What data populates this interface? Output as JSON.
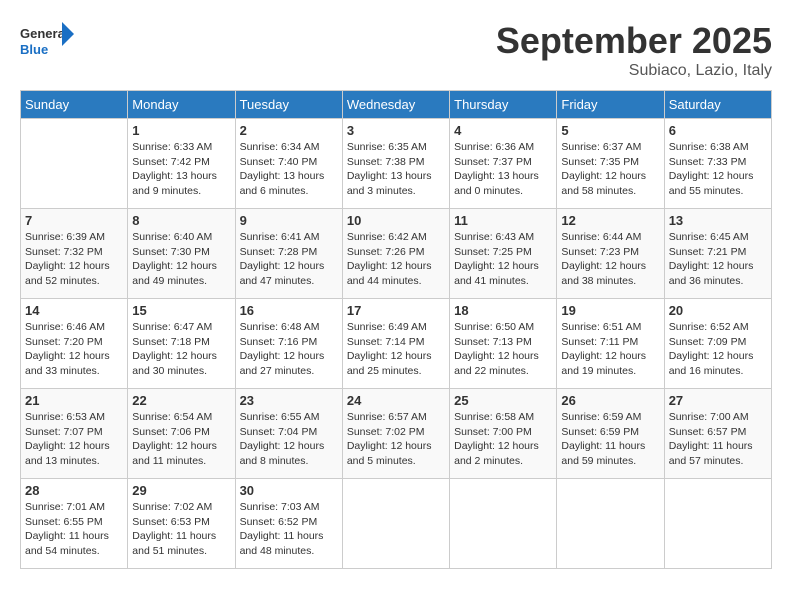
{
  "header": {
    "logo_general": "General",
    "logo_blue": "Blue",
    "month_title": "September 2025",
    "subtitle": "Subiaco, Lazio, Italy"
  },
  "weekdays": [
    "Sunday",
    "Monday",
    "Tuesday",
    "Wednesday",
    "Thursday",
    "Friday",
    "Saturday"
  ],
  "weeks": [
    [
      {
        "day": "",
        "sunrise": "",
        "sunset": "",
        "daylight": ""
      },
      {
        "day": "1",
        "sunrise": "Sunrise: 6:33 AM",
        "sunset": "Sunset: 7:42 PM",
        "daylight": "Daylight: 13 hours and 9 minutes."
      },
      {
        "day": "2",
        "sunrise": "Sunrise: 6:34 AM",
        "sunset": "Sunset: 7:40 PM",
        "daylight": "Daylight: 13 hours and 6 minutes."
      },
      {
        "day": "3",
        "sunrise": "Sunrise: 6:35 AM",
        "sunset": "Sunset: 7:38 PM",
        "daylight": "Daylight: 13 hours and 3 minutes."
      },
      {
        "day": "4",
        "sunrise": "Sunrise: 6:36 AM",
        "sunset": "Sunset: 7:37 PM",
        "daylight": "Daylight: 13 hours and 0 minutes."
      },
      {
        "day": "5",
        "sunrise": "Sunrise: 6:37 AM",
        "sunset": "Sunset: 7:35 PM",
        "daylight": "Daylight: 12 hours and 58 minutes."
      },
      {
        "day": "6",
        "sunrise": "Sunrise: 6:38 AM",
        "sunset": "Sunset: 7:33 PM",
        "daylight": "Daylight: 12 hours and 55 minutes."
      }
    ],
    [
      {
        "day": "7",
        "sunrise": "Sunrise: 6:39 AM",
        "sunset": "Sunset: 7:32 PM",
        "daylight": "Daylight: 12 hours and 52 minutes."
      },
      {
        "day": "8",
        "sunrise": "Sunrise: 6:40 AM",
        "sunset": "Sunset: 7:30 PM",
        "daylight": "Daylight: 12 hours and 49 minutes."
      },
      {
        "day": "9",
        "sunrise": "Sunrise: 6:41 AM",
        "sunset": "Sunset: 7:28 PM",
        "daylight": "Daylight: 12 hours and 47 minutes."
      },
      {
        "day": "10",
        "sunrise": "Sunrise: 6:42 AM",
        "sunset": "Sunset: 7:26 PM",
        "daylight": "Daylight: 12 hours and 44 minutes."
      },
      {
        "day": "11",
        "sunrise": "Sunrise: 6:43 AM",
        "sunset": "Sunset: 7:25 PM",
        "daylight": "Daylight: 12 hours and 41 minutes."
      },
      {
        "day": "12",
        "sunrise": "Sunrise: 6:44 AM",
        "sunset": "Sunset: 7:23 PM",
        "daylight": "Daylight: 12 hours and 38 minutes."
      },
      {
        "day": "13",
        "sunrise": "Sunrise: 6:45 AM",
        "sunset": "Sunset: 7:21 PM",
        "daylight": "Daylight: 12 hours and 36 minutes."
      }
    ],
    [
      {
        "day": "14",
        "sunrise": "Sunrise: 6:46 AM",
        "sunset": "Sunset: 7:20 PM",
        "daylight": "Daylight: 12 hours and 33 minutes."
      },
      {
        "day": "15",
        "sunrise": "Sunrise: 6:47 AM",
        "sunset": "Sunset: 7:18 PM",
        "daylight": "Daylight: 12 hours and 30 minutes."
      },
      {
        "day": "16",
        "sunrise": "Sunrise: 6:48 AM",
        "sunset": "Sunset: 7:16 PM",
        "daylight": "Daylight: 12 hours and 27 minutes."
      },
      {
        "day": "17",
        "sunrise": "Sunrise: 6:49 AM",
        "sunset": "Sunset: 7:14 PM",
        "daylight": "Daylight: 12 hours and 25 minutes."
      },
      {
        "day": "18",
        "sunrise": "Sunrise: 6:50 AM",
        "sunset": "Sunset: 7:13 PM",
        "daylight": "Daylight: 12 hours and 22 minutes."
      },
      {
        "day": "19",
        "sunrise": "Sunrise: 6:51 AM",
        "sunset": "Sunset: 7:11 PM",
        "daylight": "Daylight: 12 hours and 19 minutes."
      },
      {
        "day": "20",
        "sunrise": "Sunrise: 6:52 AM",
        "sunset": "Sunset: 7:09 PM",
        "daylight": "Daylight: 12 hours and 16 minutes."
      }
    ],
    [
      {
        "day": "21",
        "sunrise": "Sunrise: 6:53 AM",
        "sunset": "Sunset: 7:07 PM",
        "daylight": "Daylight: 12 hours and 13 minutes."
      },
      {
        "day": "22",
        "sunrise": "Sunrise: 6:54 AM",
        "sunset": "Sunset: 7:06 PM",
        "daylight": "Daylight: 12 hours and 11 minutes."
      },
      {
        "day": "23",
        "sunrise": "Sunrise: 6:55 AM",
        "sunset": "Sunset: 7:04 PM",
        "daylight": "Daylight: 12 hours and 8 minutes."
      },
      {
        "day": "24",
        "sunrise": "Sunrise: 6:57 AM",
        "sunset": "Sunset: 7:02 PM",
        "daylight": "Daylight: 12 hours and 5 minutes."
      },
      {
        "day": "25",
        "sunrise": "Sunrise: 6:58 AM",
        "sunset": "Sunset: 7:00 PM",
        "daylight": "Daylight: 12 hours and 2 minutes."
      },
      {
        "day": "26",
        "sunrise": "Sunrise: 6:59 AM",
        "sunset": "Sunset: 6:59 PM",
        "daylight": "Daylight: 11 hours and 59 minutes."
      },
      {
        "day": "27",
        "sunrise": "Sunrise: 7:00 AM",
        "sunset": "Sunset: 6:57 PM",
        "daylight": "Daylight: 11 hours and 57 minutes."
      }
    ],
    [
      {
        "day": "28",
        "sunrise": "Sunrise: 7:01 AM",
        "sunset": "Sunset: 6:55 PM",
        "daylight": "Daylight: 11 hours and 54 minutes."
      },
      {
        "day": "29",
        "sunrise": "Sunrise: 7:02 AM",
        "sunset": "Sunset: 6:53 PM",
        "daylight": "Daylight: 11 hours and 51 minutes."
      },
      {
        "day": "30",
        "sunrise": "Sunrise: 7:03 AM",
        "sunset": "Sunset: 6:52 PM",
        "daylight": "Daylight: 11 hours and 48 minutes."
      },
      {
        "day": "",
        "sunrise": "",
        "sunset": "",
        "daylight": ""
      },
      {
        "day": "",
        "sunrise": "",
        "sunset": "",
        "daylight": ""
      },
      {
        "day": "",
        "sunrise": "",
        "sunset": "",
        "daylight": ""
      },
      {
        "day": "",
        "sunrise": "",
        "sunset": "",
        "daylight": ""
      }
    ]
  ]
}
